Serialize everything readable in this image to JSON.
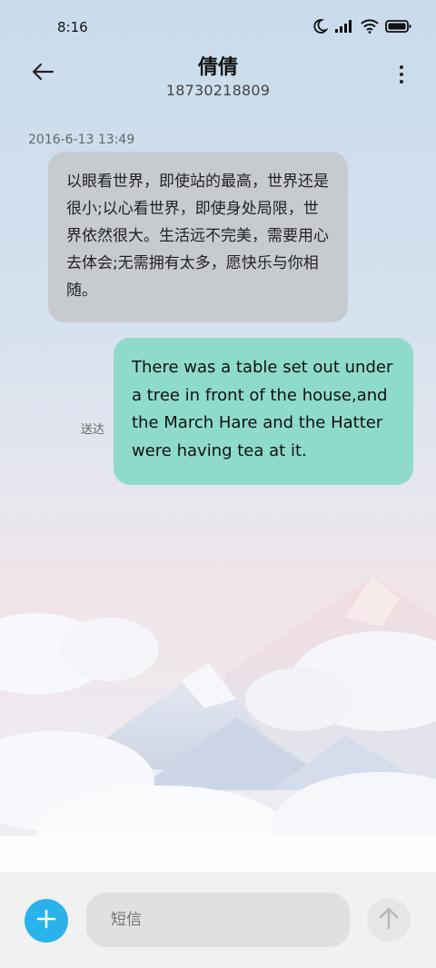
{
  "status_bar": {
    "time": "8:16",
    "icons": [
      "moon-icon",
      "signal-icon",
      "wifi-icon",
      "battery-icon"
    ]
  },
  "header": {
    "title": "倩倩",
    "subtitle": "18730218809",
    "back_icon": "arrow-left-icon",
    "more_icon": "more-vertical-icon"
  },
  "conversation": {
    "timestamp": "2016-6-13 13:49",
    "incoming_message": "以眼看世界，即使站的最高，世界还是很小;以心看世界，即使身处局限，世界依然很大。生活远不完美，需要用心去体会;无需拥有太多，愿快乐与你相随。",
    "outgoing_message": "There was a table set out under a tree in front of the house,and the March Hare and the Hatter were having tea at it.",
    "outgoing_status": "送达"
  },
  "compose": {
    "placeholder": "短信",
    "add_icon": "plus-icon",
    "send_icon": "arrow-up-icon"
  },
  "colors": {
    "incoming_bubble": "#c7cbd0",
    "outgoing_bubble": "#8edbcb",
    "add_button": "#2ab3ea"
  }
}
